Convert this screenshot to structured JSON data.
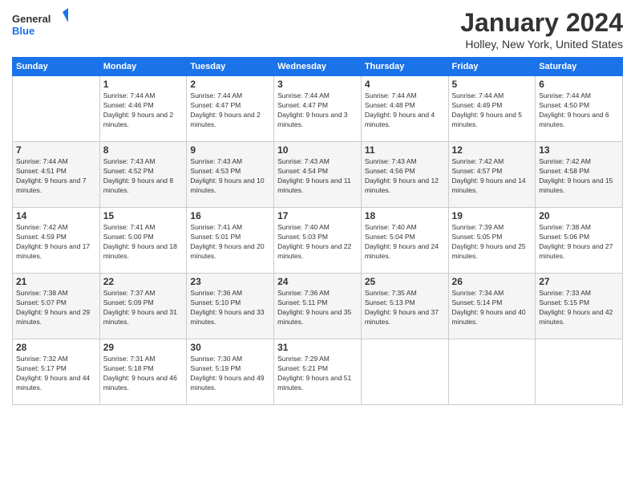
{
  "header": {
    "logo_line1": "General",
    "logo_line2": "Blue",
    "month": "January 2024",
    "location": "Holley, New York, United States"
  },
  "weekdays": [
    "Sunday",
    "Monday",
    "Tuesday",
    "Wednesday",
    "Thursday",
    "Friday",
    "Saturday"
  ],
  "weeks": [
    [
      {
        "day": "",
        "sunrise": "",
        "sunset": "",
        "daylight": ""
      },
      {
        "day": "1",
        "sunrise": "Sunrise: 7:44 AM",
        "sunset": "Sunset: 4:46 PM",
        "daylight": "Daylight: 9 hours and 2 minutes."
      },
      {
        "day": "2",
        "sunrise": "Sunrise: 7:44 AM",
        "sunset": "Sunset: 4:47 PM",
        "daylight": "Daylight: 9 hours and 2 minutes."
      },
      {
        "day": "3",
        "sunrise": "Sunrise: 7:44 AM",
        "sunset": "Sunset: 4:47 PM",
        "daylight": "Daylight: 9 hours and 3 minutes."
      },
      {
        "day": "4",
        "sunrise": "Sunrise: 7:44 AM",
        "sunset": "Sunset: 4:48 PM",
        "daylight": "Daylight: 9 hours and 4 minutes."
      },
      {
        "day": "5",
        "sunrise": "Sunrise: 7:44 AM",
        "sunset": "Sunset: 4:49 PM",
        "daylight": "Daylight: 9 hours and 5 minutes."
      },
      {
        "day": "6",
        "sunrise": "Sunrise: 7:44 AM",
        "sunset": "Sunset: 4:50 PM",
        "daylight": "Daylight: 9 hours and 6 minutes."
      }
    ],
    [
      {
        "day": "7",
        "sunrise": "Sunrise: 7:44 AM",
        "sunset": "Sunset: 4:51 PM",
        "daylight": "Daylight: 9 hours and 7 minutes."
      },
      {
        "day": "8",
        "sunrise": "Sunrise: 7:43 AM",
        "sunset": "Sunset: 4:52 PM",
        "daylight": "Daylight: 9 hours and 8 minutes."
      },
      {
        "day": "9",
        "sunrise": "Sunrise: 7:43 AM",
        "sunset": "Sunset: 4:53 PM",
        "daylight": "Daylight: 9 hours and 10 minutes."
      },
      {
        "day": "10",
        "sunrise": "Sunrise: 7:43 AM",
        "sunset": "Sunset: 4:54 PM",
        "daylight": "Daylight: 9 hours and 11 minutes."
      },
      {
        "day": "11",
        "sunrise": "Sunrise: 7:43 AM",
        "sunset": "Sunset: 4:56 PM",
        "daylight": "Daylight: 9 hours and 12 minutes."
      },
      {
        "day": "12",
        "sunrise": "Sunrise: 7:42 AM",
        "sunset": "Sunset: 4:57 PM",
        "daylight": "Daylight: 9 hours and 14 minutes."
      },
      {
        "day": "13",
        "sunrise": "Sunrise: 7:42 AM",
        "sunset": "Sunset: 4:58 PM",
        "daylight": "Daylight: 9 hours and 15 minutes."
      }
    ],
    [
      {
        "day": "14",
        "sunrise": "Sunrise: 7:42 AM",
        "sunset": "Sunset: 4:59 PM",
        "daylight": "Daylight: 9 hours and 17 minutes."
      },
      {
        "day": "15",
        "sunrise": "Sunrise: 7:41 AM",
        "sunset": "Sunset: 5:00 PM",
        "daylight": "Daylight: 9 hours and 18 minutes."
      },
      {
        "day": "16",
        "sunrise": "Sunrise: 7:41 AM",
        "sunset": "Sunset: 5:01 PM",
        "daylight": "Daylight: 9 hours and 20 minutes."
      },
      {
        "day": "17",
        "sunrise": "Sunrise: 7:40 AM",
        "sunset": "Sunset: 5:03 PM",
        "daylight": "Daylight: 9 hours and 22 minutes."
      },
      {
        "day": "18",
        "sunrise": "Sunrise: 7:40 AM",
        "sunset": "Sunset: 5:04 PM",
        "daylight": "Daylight: 9 hours and 24 minutes."
      },
      {
        "day": "19",
        "sunrise": "Sunrise: 7:39 AM",
        "sunset": "Sunset: 5:05 PM",
        "daylight": "Daylight: 9 hours and 25 minutes."
      },
      {
        "day": "20",
        "sunrise": "Sunrise: 7:38 AM",
        "sunset": "Sunset: 5:06 PM",
        "daylight": "Daylight: 9 hours and 27 minutes."
      }
    ],
    [
      {
        "day": "21",
        "sunrise": "Sunrise: 7:38 AM",
        "sunset": "Sunset: 5:07 PM",
        "daylight": "Daylight: 9 hours and 29 minutes."
      },
      {
        "day": "22",
        "sunrise": "Sunrise: 7:37 AM",
        "sunset": "Sunset: 5:09 PM",
        "daylight": "Daylight: 9 hours and 31 minutes."
      },
      {
        "day": "23",
        "sunrise": "Sunrise: 7:36 AM",
        "sunset": "Sunset: 5:10 PM",
        "daylight": "Daylight: 9 hours and 33 minutes."
      },
      {
        "day": "24",
        "sunrise": "Sunrise: 7:36 AM",
        "sunset": "Sunset: 5:11 PM",
        "daylight": "Daylight: 9 hours and 35 minutes."
      },
      {
        "day": "25",
        "sunrise": "Sunrise: 7:35 AM",
        "sunset": "Sunset: 5:13 PM",
        "daylight": "Daylight: 9 hours and 37 minutes."
      },
      {
        "day": "26",
        "sunrise": "Sunrise: 7:34 AM",
        "sunset": "Sunset: 5:14 PM",
        "daylight": "Daylight: 9 hours and 40 minutes."
      },
      {
        "day": "27",
        "sunrise": "Sunrise: 7:33 AM",
        "sunset": "Sunset: 5:15 PM",
        "daylight": "Daylight: 9 hours and 42 minutes."
      }
    ],
    [
      {
        "day": "28",
        "sunrise": "Sunrise: 7:32 AM",
        "sunset": "Sunset: 5:17 PM",
        "daylight": "Daylight: 9 hours and 44 minutes."
      },
      {
        "day": "29",
        "sunrise": "Sunrise: 7:31 AM",
        "sunset": "Sunset: 5:18 PM",
        "daylight": "Daylight: 9 hours and 46 minutes."
      },
      {
        "day": "30",
        "sunrise": "Sunrise: 7:30 AM",
        "sunset": "Sunset: 5:19 PM",
        "daylight": "Daylight: 9 hours and 49 minutes."
      },
      {
        "day": "31",
        "sunrise": "Sunrise: 7:29 AM",
        "sunset": "Sunset: 5:21 PM",
        "daylight": "Daylight: 9 hours and 51 minutes."
      },
      {
        "day": "",
        "sunrise": "",
        "sunset": "",
        "daylight": ""
      },
      {
        "day": "",
        "sunrise": "",
        "sunset": "",
        "daylight": ""
      },
      {
        "day": "",
        "sunrise": "",
        "sunset": "",
        "daylight": ""
      }
    ]
  ]
}
